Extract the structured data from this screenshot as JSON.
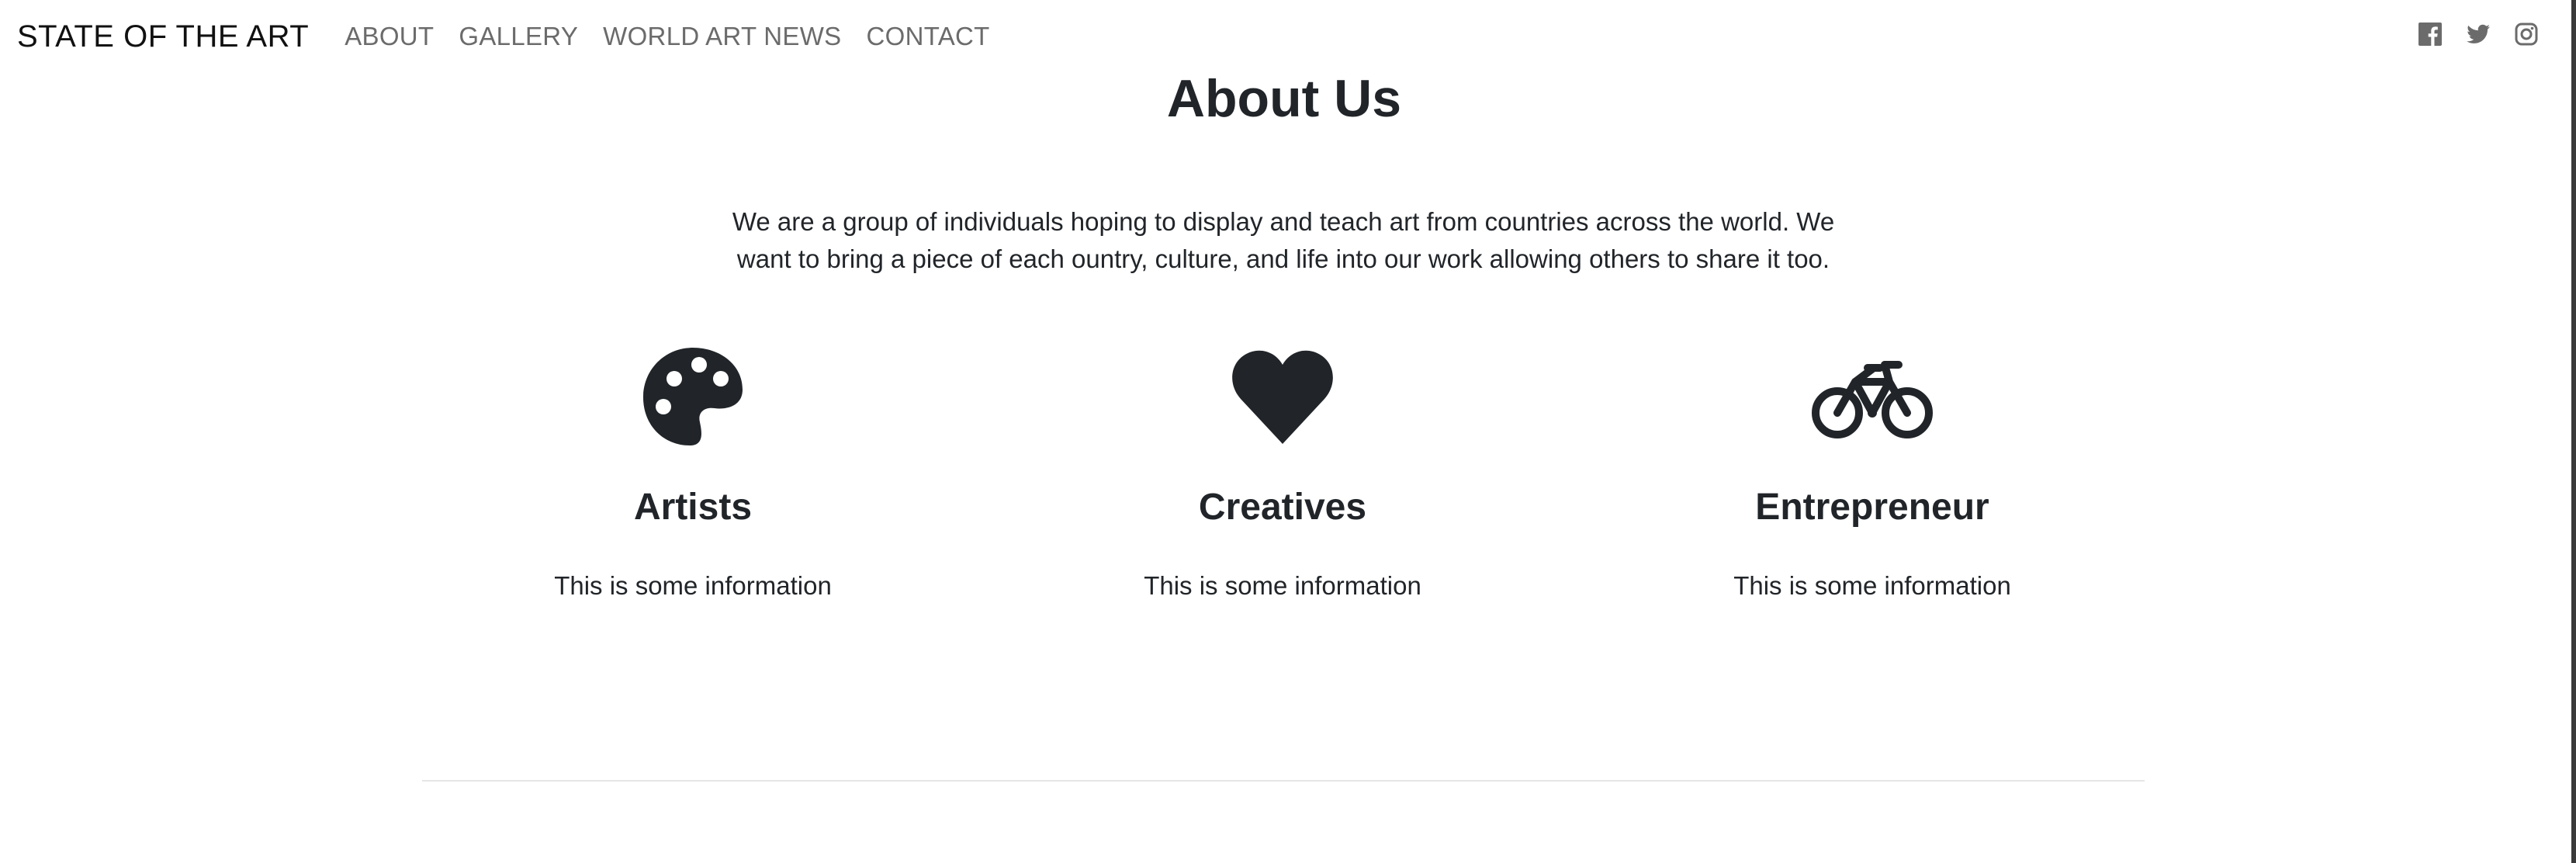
{
  "navbar": {
    "brand": "STATE OF THE ART",
    "links": [
      "ABOUT",
      "GALLERY",
      "WORLD ART NEWS",
      "CONTACT"
    ],
    "social": [
      "facebook-icon",
      "twitter-icon",
      "instagram-icon"
    ]
  },
  "about": {
    "title": "About Us",
    "intro": "We are a group of individuals hoping to display and teach art from countries across the world. We want to bring a piece of each ountry, culture, and life into our work allowing others to share it too."
  },
  "features": [
    {
      "icon": "palette-icon",
      "title": "Artists",
      "text": "This is some information"
    },
    {
      "icon": "heart-icon",
      "title": "Creatives",
      "text": "This is some information"
    },
    {
      "icon": "bicycle-icon",
      "title": "Entrepreneur",
      "text": "This is some information"
    }
  ],
  "colors": {
    "text": "#212529",
    "nav_link": "#6b6b6b",
    "divider": "#e6e6e6"
  }
}
